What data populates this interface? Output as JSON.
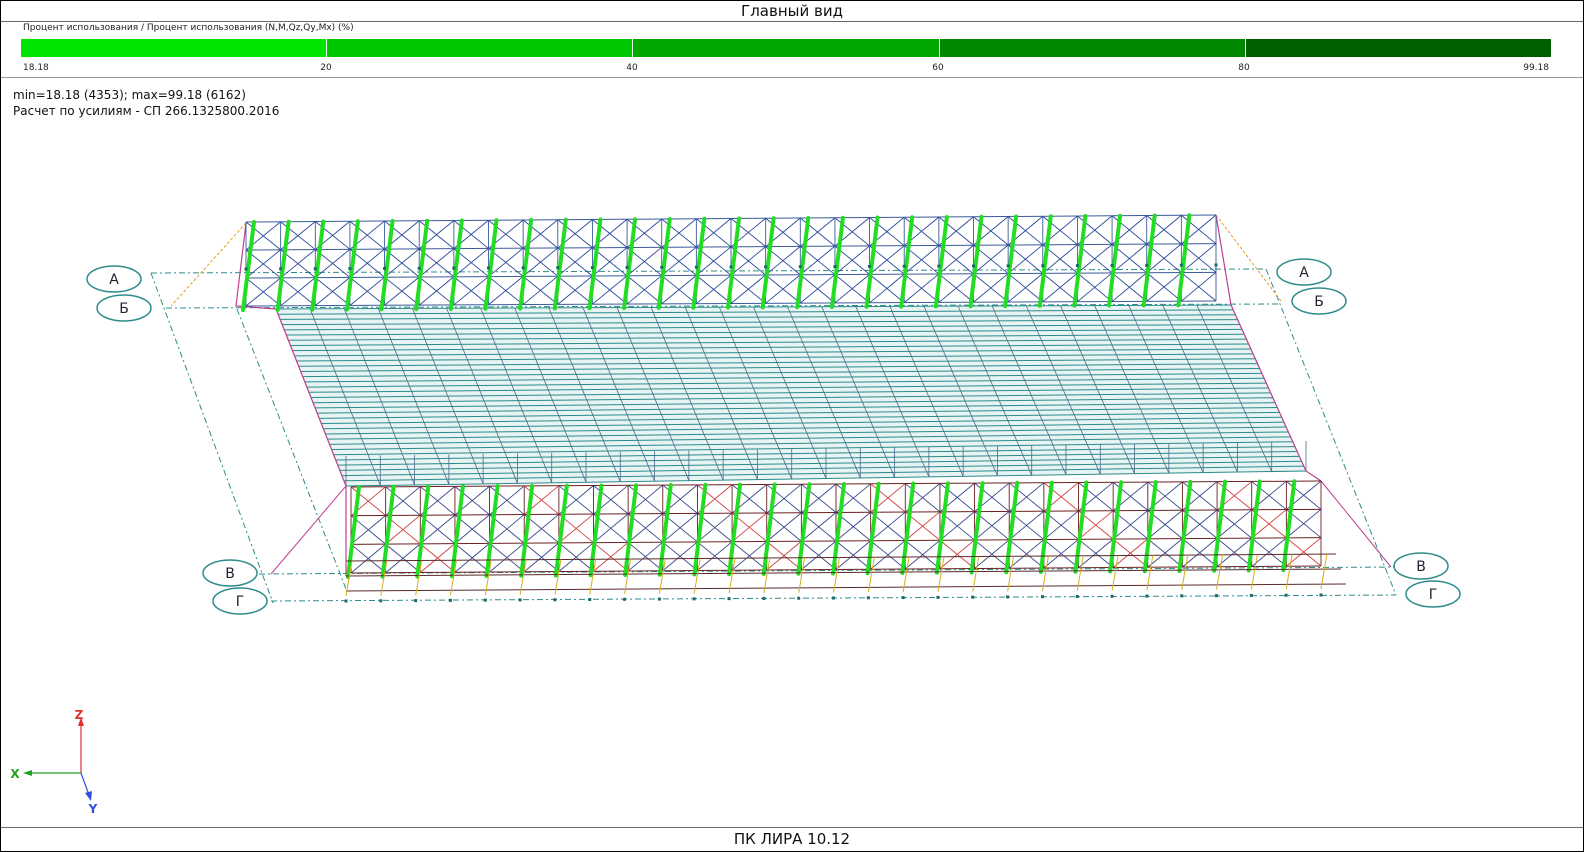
{
  "window": {
    "title": "Главный вид"
  },
  "legend": {
    "title": "Процент использования / Процент использования (N,M,Qz,Qy,Mx) (%)",
    "scale_colors": [
      "#00e400",
      "#00c800",
      "#00a800",
      "#008800",
      "#006000"
    ],
    "scale_labels": [
      "18.18",
      "20",
      "40",
      "60",
      "80",
      "99.18"
    ]
  },
  "info": {
    "minmax": "min=18.18 (4353); max=99.18 (6162)",
    "code": "Расчет по усилиям - СП 266.1325800.2016"
  },
  "grid_axes": {
    "left": [
      "А",
      "Б",
      "В",
      "Г"
    ],
    "right": [
      "А",
      "Б",
      "В",
      "Г"
    ]
  },
  "coord_triad": {
    "x": "X",
    "y": "Y",
    "z": "Z"
  },
  "footer": {
    "product": "ПК ЛИРА 10.12"
  }
}
